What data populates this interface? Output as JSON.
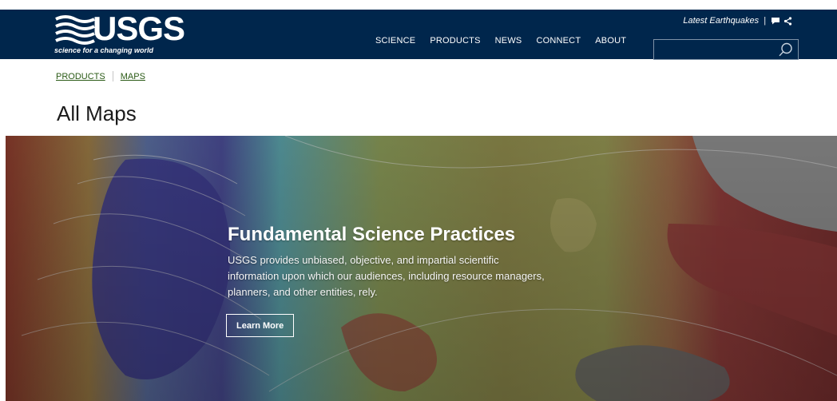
{
  "header": {
    "logo_text": "USGS",
    "logo_tagline": "science for a changing world",
    "nav": [
      {
        "label": "SCIENCE"
      },
      {
        "label": "PRODUCTS"
      },
      {
        "label": "NEWS"
      },
      {
        "label": "CONNECT"
      },
      {
        "label": "ABOUT"
      }
    ],
    "utility_link": "Latest Earthquakes",
    "utility_separator": "|",
    "icons": [
      "chat-icon",
      "share-icon",
      "search-icon"
    ],
    "search": {
      "value": "",
      "placeholder": ""
    }
  },
  "breadcrumb": [
    {
      "label": "PRODUCTS"
    },
    {
      "label": "MAPS"
    }
  ],
  "page": {
    "title": "All Maps"
  },
  "hero": {
    "title": "Fundamental Science Practices",
    "text": "USGS provides unbiased, objective, and impartial scientific information upon which our audiences, including resource managers, planners, and other entities, rely.",
    "button_label": "Learn More"
  },
  "colors": {
    "header_bg": "#00264c",
    "breadcrumb_link": "#2a5a15",
    "title": "#1b1b1b"
  }
}
